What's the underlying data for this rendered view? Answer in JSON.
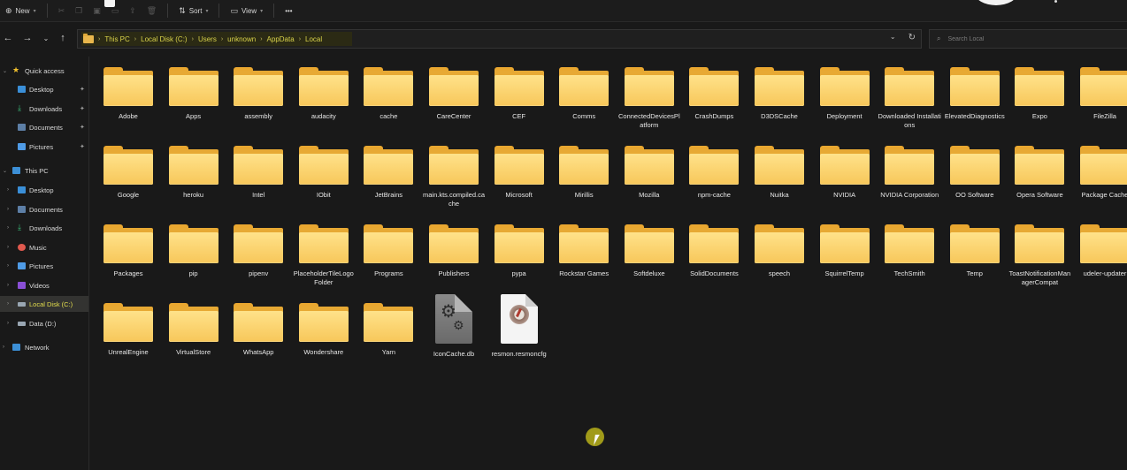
{
  "toolbar": {
    "new_label": "New",
    "sort_label": "Sort",
    "view_label": "View",
    "more_label": "•••"
  },
  "breadcrumb": [
    "This PC",
    "Local Disk (C:)",
    "Users",
    "unknown",
    "AppData",
    "Local"
  ],
  "search": {
    "placeholder": "Search Local"
  },
  "sidebar": {
    "quick_access": "Quick access",
    "quick_items": [
      "Desktop",
      "Downloads",
      "Documents",
      "Pictures"
    ],
    "this_pc": "This PC",
    "pc_items": [
      "Desktop",
      "Documents",
      "Downloads",
      "Music",
      "Pictures",
      "Videos",
      "Local Disk (C:)",
      "Data (D:)"
    ],
    "network": "Network"
  },
  "items": [
    "Adobe",
    "Apps",
    "assembly",
    "audacity",
    "cache",
    "CareCenter",
    "CEF",
    "Comms",
    "ConnectedDevicesPlatform",
    "CrashDumps",
    "D3DSCache",
    "Deployment",
    "Downloaded Installations",
    "ElevatedDiagnostics",
    "Expo",
    "FileZilla",
    "Google",
    "heroku",
    "Intel",
    "IObit",
    "JetBrains",
    "main.kts.compiled.cache",
    "Microsoft",
    "Mirillis",
    "Mozilla",
    "npm-cache",
    "Nuitka",
    "NVIDIA",
    "NVIDIA Corporation",
    "OO Software",
    "Opera Software",
    "Package Cache",
    "Packages",
    "pip",
    "pipenv",
    "PlaceholderTileLogoFolder",
    "Programs",
    "Publishers",
    "pypa",
    "Rockstar Games",
    "Softdeluxe",
    "SolidDocuments",
    "speech",
    "SquirrelTemp",
    "TechSmith",
    "Temp",
    "ToastNotificationManagerCompat",
    "udeler-updater",
    "UnrealEngine",
    "VirtualStore",
    "WhatsApp",
    "Wondershare",
    "Yarn",
    "IconCache.db",
    "resmon.resmoncfg"
  ],
  "colors": {
    "accent_active": "#e5df4d",
    "folder": "#f7c75a",
    "background": "#191919"
  }
}
